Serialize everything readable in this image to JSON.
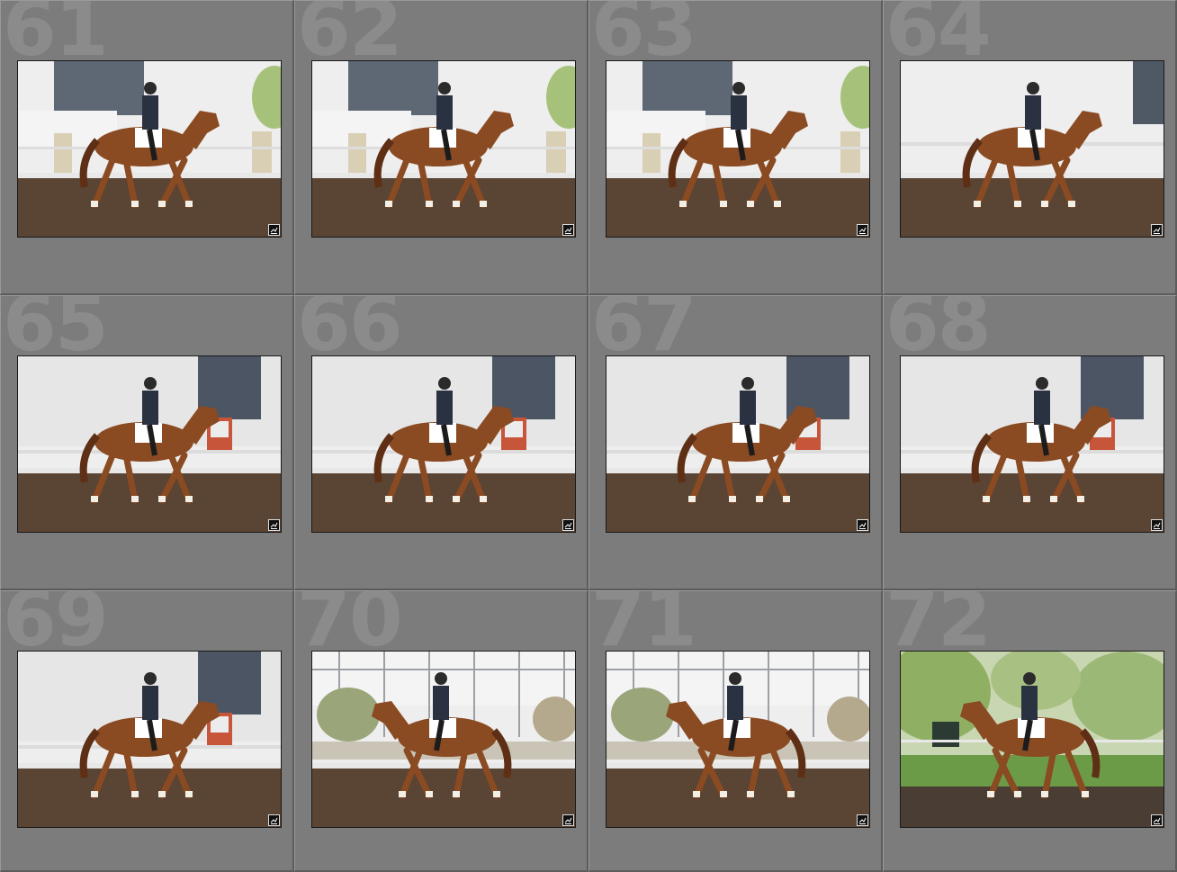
{
  "photos": [
    {
      "index": "61",
      "scene": "arena-side",
      "facing": "right",
      "badge_icon": "develop-adjusted-icon"
    },
    {
      "index": "62",
      "scene": "arena-side",
      "facing": "right",
      "badge_icon": "develop-adjusted-icon"
    },
    {
      "index": "63",
      "scene": "arena-side",
      "facing": "right",
      "badge_icon": "develop-adjusted-icon"
    },
    {
      "index": "64",
      "scene": "arena-far",
      "facing": "right",
      "badge_icon": "develop-adjusted-icon"
    },
    {
      "index": "65",
      "scene": "arena-white",
      "facing": "right",
      "badge_icon": "develop-adjusted-icon"
    },
    {
      "index": "66",
      "scene": "arena-white",
      "facing": "right",
      "badge_icon": "develop-adjusted-icon"
    },
    {
      "index": "67",
      "scene": "arena-white",
      "facing": "front",
      "badge_icon": "develop-adjusted-icon"
    },
    {
      "index": "68",
      "scene": "arena-white",
      "facing": "front",
      "badge_icon": "develop-adjusted-icon"
    },
    {
      "index": "69",
      "scene": "arena-white",
      "facing": "right",
      "badge_icon": "develop-adjusted-icon"
    },
    {
      "index": "70",
      "scene": "arena-frame",
      "facing": "left",
      "badge_icon": "develop-adjusted-icon"
    },
    {
      "index": "71",
      "scene": "arena-frame",
      "facing": "left",
      "badge_icon": "develop-adjusted-icon"
    },
    {
      "index": "72",
      "scene": "outdoor-green",
      "facing": "left",
      "badge_icon": "develop-adjusted-icon"
    }
  ],
  "colors": {
    "cell_bg": "#7c7c7c",
    "index_text": "#8b8b8b",
    "arena_dirt": "#5a4434",
    "horse": "#8a4a22",
    "rider_jacket": "#2a3140"
  }
}
